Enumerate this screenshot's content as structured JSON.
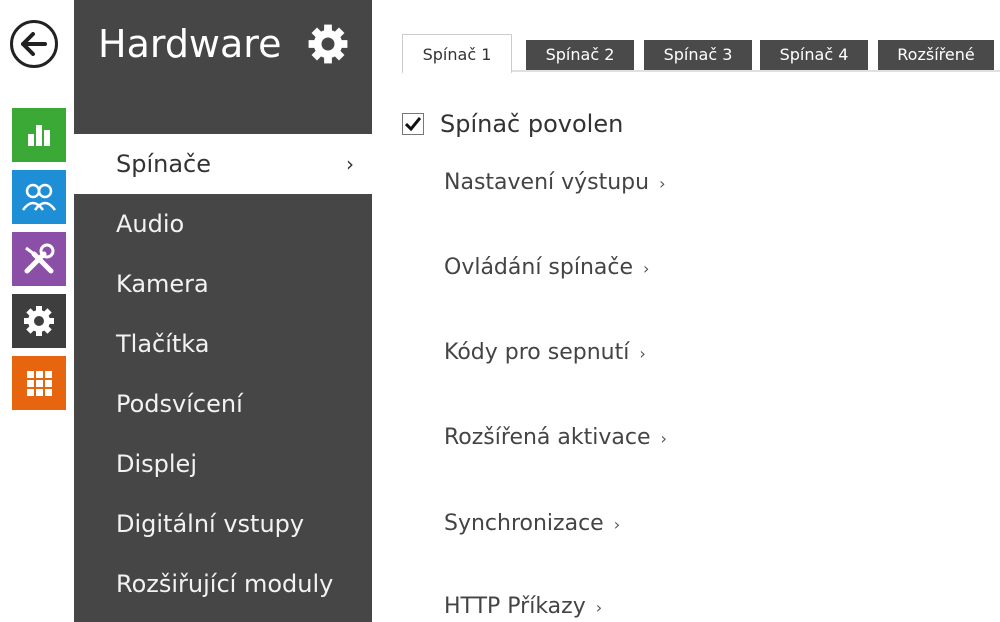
{
  "app": {
    "title": "Hardware",
    "icons": {
      "back": "arrow-left-icon",
      "settings": "gear-icon",
      "status": "bar-chart-icon",
      "users": "users-icon",
      "services": "tools-icon",
      "hardware": "gear-icon",
      "system": "grid-icon"
    },
    "colors": {
      "status": "#3aa935",
      "users": "#1e8fd6",
      "services": "#8b4fa8",
      "hardware": "#3e3e3e",
      "system": "#e8650f",
      "sidebar": "#464646"
    }
  },
  "sidebar": {
    "items": [
      {
        "label": "Spínače",
        "active": true,
        "arrow": "›"
      },
      {
        "label": "Audio"
      },
      {
        "label": "Kamera"
      },
      {
        "label": "Tlačítka"
      },
      {
        "label": "Podsvícení"
      },
      {
        "label": "Displej"
      },
      {
        "label": "Digitální vstupy"
      },
      {
        "label": "Rozšiřující moduly"
      }
    ]
  },
  "tabs": [
    {
      "label": "Spínač 1",
      "active": true
    },
    {
      "label": "Spínač 2"
    },
    {
      "label": "Spínač 3"
    },
    {
      "label": "Spínač 4"
    },
    {
      "label": "Rozšířené"
    }
  ],
  "main": {
    "checkbox": {
      "label": "Spínač povolen",
      "checked": true
    },
    "sections": [
      {
        "label": "Nastavení výstupu",
        "chevron": "›"
      },
      {
        "label": "Ovládání spínače",
        "chevron": "›"
      },
      {
        "label": "Kódy pro sepnutí",
        "chevron": "›"
      },
      {
        "label": "Rozšířená aktivace",
        "chevron": "›"
      },
      {
        "label": "Synchronizace",
        "chevron": "›"
      },
      {
        "label": "HTTP Příkazy",
        "chevron": "›"
      }
    ]
  }
}
